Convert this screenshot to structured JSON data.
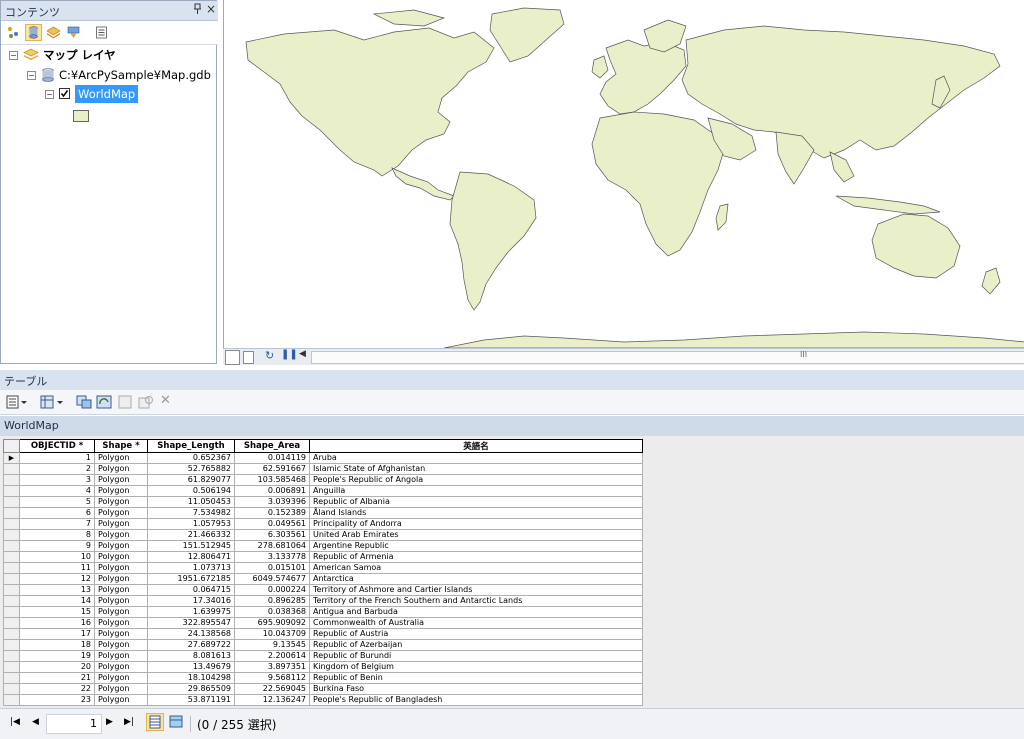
{
  "contents": {
    "title": "コンテンツ",
    "pin_glyph": "ᵖ",
    "close_glyph": "×",
    "toolbar_icons": [
      "list-by-drawing-order-icon",
      "list-by-source-icon",
      "list-by-visibility-icon",
      "list-by-selection-icon",
      "options-icon"
    ],
    "tree": {
      "map_layers_label": "マップ レイヤ",
      "gdb_path": "C:¥ArcPySample¥Map.gdb",
      "layer_name": "WorldMap",
      "layer_checked": true,
      "symbol_color": "#e9efc9"
    }
  },
  "map": {
    "land_color": "#e9efc9",
    "statusbar_scroll_glyph": "III"
  },
  "table_panel": {
    "title": "テーブル",
    "tab_title": "WorldMap",
    "columns": [
      "OBJECTID *",
      "Shape *",
      "Shape_Length",
      "Shape_Area",
      "英語名"
    ],
    "rows": [
      [
        "1",
        "Polygon",
        "0.652367",
        "0.014119",
        "Aruba"
      ],
      [
        "2",
        "Polygon",
        "52.765882",
        "62.591667",
        "Islamic State of Afghanistan"
      ],
      [
        "3",
        "Polygon",
        "61.829077",
        "103.585468",
        "People's Republic of Angola"
      ],
      [
        "4",
        "Polygon",
        "0.506194",
        "0.006891",
        "Anguilla"
      ],
      [
        "5",
        "Polygon",
        "11.050453",
        "3.039396",
        "Republic of Albania"
      ],
      [
        "6",
        "Polygon",
        "7.534982",
        "0.152389",
        "Åland Islands"
      ],
      [
        "7",
        "Polygon",
        "1.057953",
        "0.049561",
        "Principality of Andorra"
      ],
      [
        "8",
        "Polygon",
        "21.466332",
        "6.303561",
        "United Arab Emirates"
      ],
      [
        "9",
        "Polygon",
        "151.512945",
        "278.681064",
        "Argentine Republic"
      ],
      [
        "10",
        "Polygon",
        "12.806471",
        "3.133778",
        "Republic of Armenia"
      ],
      [
        "11",
        "Polygon",
        "1.073713",
        "0.015101",
        "American Samoa"
      ],
      [
        "12",
        "Polygon",
        "1951.672185",
        "6049.574677",
        "Antarctica"
      ],
      [
        "13",
        "Polygon",
        "0.064715",
        "0.000224",
        "Territory of Ashmore and Cartier Islands"
      ],
      [
        "14",
        "Polygon",
        "17.34016",
        "0.896285",
        "Territory of the French Southern and Antarctic Lands"
      ],
      [
        "15",
        "Polygon",
        "1.639975",
        "0.038368",
        "Antigua and Barbuda"
      ],
      [
        "16",
        "Polygon",
        "322.895547",
        "695.909092",
        "Commonwealth of Australia"
      ],
      [
        "17",
        "Polygon",
        "24.138568",
        "10.043709",
        "Republic of Austria"
      ],
      [
        "18",
        "Polygon",
        "27.689722",
        "9.13545",
        "Republic of Azerbaijan"
      ],
      [
        "19",
        "Polygon",
        "8.081613",
        "2.200614",
        "Republic of Burundi"
      ],
      [
        "20",
        "Polygon",
        "13.49679",
        "3.897351",
        "Kingdom of Belgium"
      ],
      [
        "21",
        "Polygon",
        "18.104298",
        "9.568112",
        "Republic of Benin"
      ],
      [
        "22",
        "Polygon",
        "29.865509",
        "22.569045",
        "Burkina Faso"
      ],
      [
        "23",
        "Polygon",
        "53.871191",
        "12.136247",
        "People's Republic of Bangladesh"
      ]
    ],
    "nav": {
      "first_glyph": "⏮",
      "prev_glyph": "◀",
      "record_value": "1",
      "next_glyph": "▶",
      "last_glyph": "⏭",
      "status": "(0 / 255 選択)"
    }
  }
}
